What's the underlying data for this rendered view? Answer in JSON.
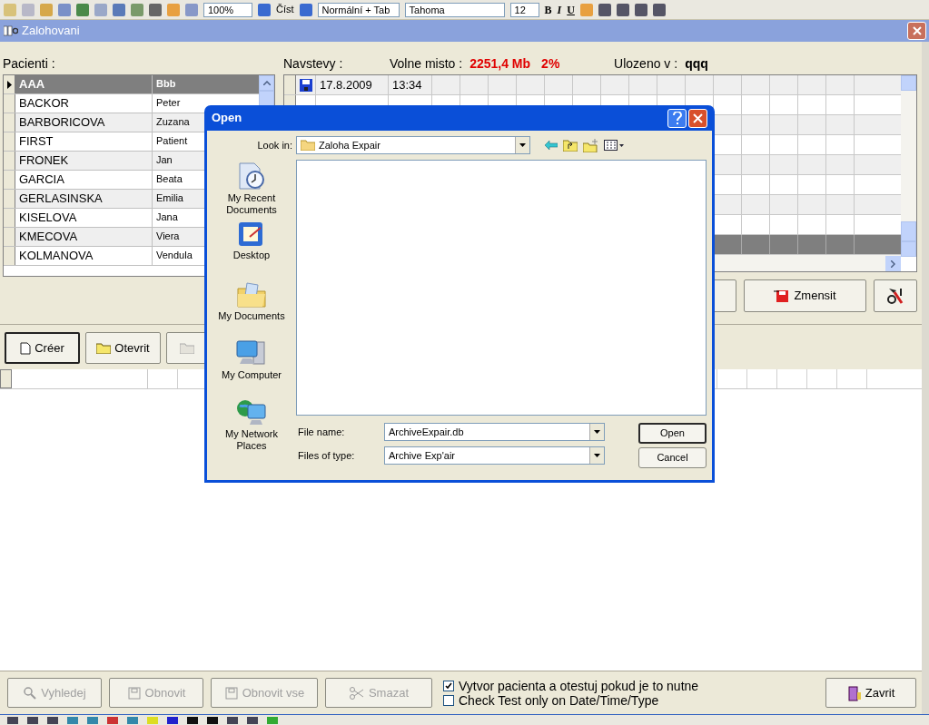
{
  "toolbar": {
    "zoom": "100%",
    "read": "Číst",
    "style": "Normální + Tab",
    "font": "Tahoma",
    "size": "12",
    "format_buttons": [
      "B",
      "I",
      "U"
    ]
  },
  "window": {
    "title": "Zalohovani"
  },
  "patients": {
    "label": "Pacienti :",
    "rows": [
      {
        "last": "AAA",
        "first": "Bbb",
        "selected": true
      },
      {
        "last": "BACKOR",
        "first": "Peter",
        "selected": false
      },
      {
        "last": "BARBORICOVA",
        "first": "Zuzana",
        "selected": false
      },
      {
        "last": "FIRST",
        "first": "Patient",
        "selected": false
      },
      {
        "last": "FRONEK",
        "first": "Jan",
        "selected": false
      },
      {
        "last": "GARCIA",
        "first": "Beata",
        "selected": false
      },
      {
        "last": "GERLASINSKA",
        "first": "Emilia",
        "selected": false
      },
      {
        "last": "KISELOVA",
        "first": "Jana",
        "selected": false
      },
      {
        "last": "KMECOVA",
        "first": "Viera",
        "selected": false
      },
      {
        "last": "KOLMANOVA",
        "first": "Vendula",
        "selected": false
      }
    ]
  },
  "visits": {
    "label": "Navstevy :",
    "free_label": "Volne misto :",
    "free_space": "2251,4 Mb",
    "free_percent": "2%",
    "saved_label": "Ulozeno v :",
    "saved_in": "qqq",
    "rows": [
      {
        "date": "17.8.2009",
        "time": "13:34",
        "selected": false
      },
      {
        "selected": false
      },
      {
        "selected": false
      },
      {
        "selected": false
      },
      {
        "selected": false
      },
      {
        "selected": false
      },
      {
        "selected": false
      },
      {
        "selected": false
      },
      {
        "selected": true
      }
    ]
  },
  "shrink_button": "Zmensit",
  "doc_buttons": [
    {
      "label": "Créer",
      "focused": true,
      "disabled": false
    },
    {
      "label": "Otevrit",
      "focused": false,
      "disabled": false
    }
  ],
  "bottom_buttons": [
    {
      "label": "Vyhledej",
      "kind": "search",
      "disabled": true
    },
    {
      "label": "Obnovit",
      "kind": "disk",
      "disabled": true
    },
    {
      "label": "Obnovit vse",
      "kind": "disk",
      "disabled": true
    },
    {
      "label": "Smazat",
      "kind": "scissors",
      "disabled": true
    }
  ],
  "options": [
    {
      "label": "Vytvor pacienta a otestuj pokud je to nutne",
      "checked": true
    },
    {
      "label": "Check Test only on Date/Time/Type",
      "checked": false
    }
  ],
  "close_button": "Zavrit",
  "dialog": {
    "title": "Open",
    "look_in_label": "Look in:",
    "look_in": "Zaloha Expair",
    "places": [
      {
        "label": "My Recent Documents",
        "kind": "recent"
      },
      {
        "label": "Desktop",
        "kind": "desktop"
      },
      {
        "label": "My Documents",
        "kind": "documents"
      },
      {
        "label": "My Computer",
        "kind": "computer"
      },
      {
        "label": "My Network Places",
        "kind": "network"
      }
    ],
    "file_name_label": "File name:",
    "file_name": "ArchiveExpair.db",
    "file_type_label": "Files of type:",
    "file_type": "Archive Exp'air",
    "open_button": "Open",
    "cancel_button": "Cancel"
  }
}
